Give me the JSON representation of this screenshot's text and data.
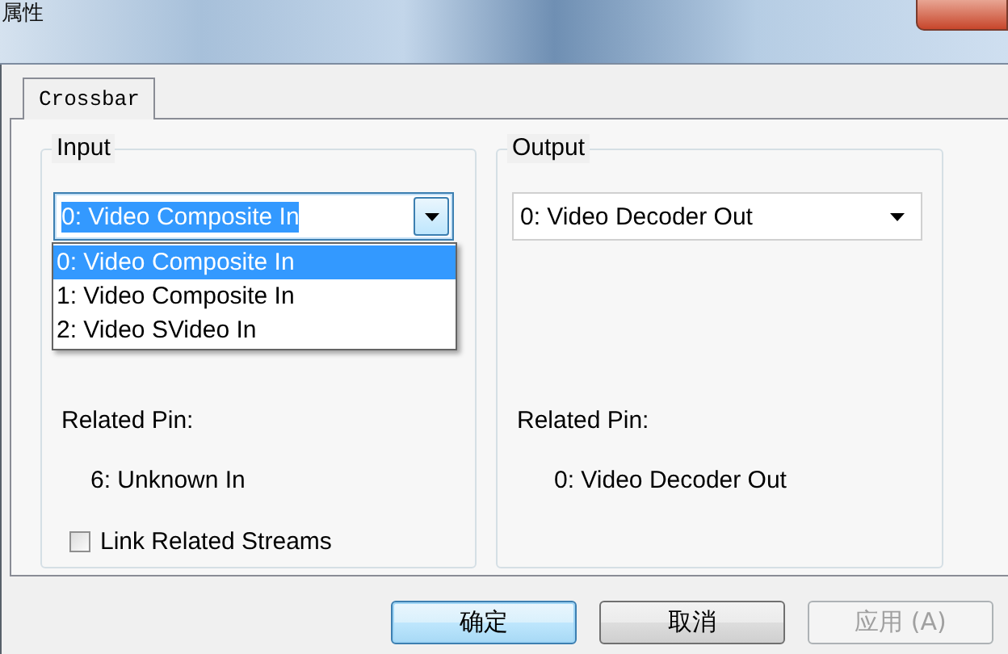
{
  "window": {
    "title": "属性"
  },
  "tabs": [
    {
      "label": "Crossbar",
      "selected": true
    }
  ],
  "input": {
    "title": "Input",
    "selector": {
      "kind": "editable",
      "value": "0: Video Composite In",
      "focused": true,
      "expanded": true,
      "options": [
        {
          "label": "0: Video Composite In",
          "selected": true
        },
        {
          "label": "1: Video Composite In",
          "selected": false
        },
        {
          "label": "2: Video SVideo In",
          "selected": false
        }
      ]
    },
    "related_pin_label": "Related Pin:",
    "related_pin": "6: Unknown In",
    "link_related_streams": {
      "label": "Link Related Streams",
      "checked": false
    }
  },
  "output": {
    "title": "Output",
    "selector": {
      "kind": "dropdown",
      "value": "0: Video Decoder Out",
      "focused": false,
      "expanded": false
    },
    "related_pin_label": "Related Pin:",
    "related_pin": "0: Video Decoder Out"
  },
  "buttons": [
    {
      "label": "确定",
      "kind": "default",
      "disabled": false
    },
    {
      "label": "取消",
      "kind": "normal",
      "disabled": false
    },
    {
      "label": "应用 (A)",
      "kind": "normal",
      "disabled": true
    }
  ]
}
